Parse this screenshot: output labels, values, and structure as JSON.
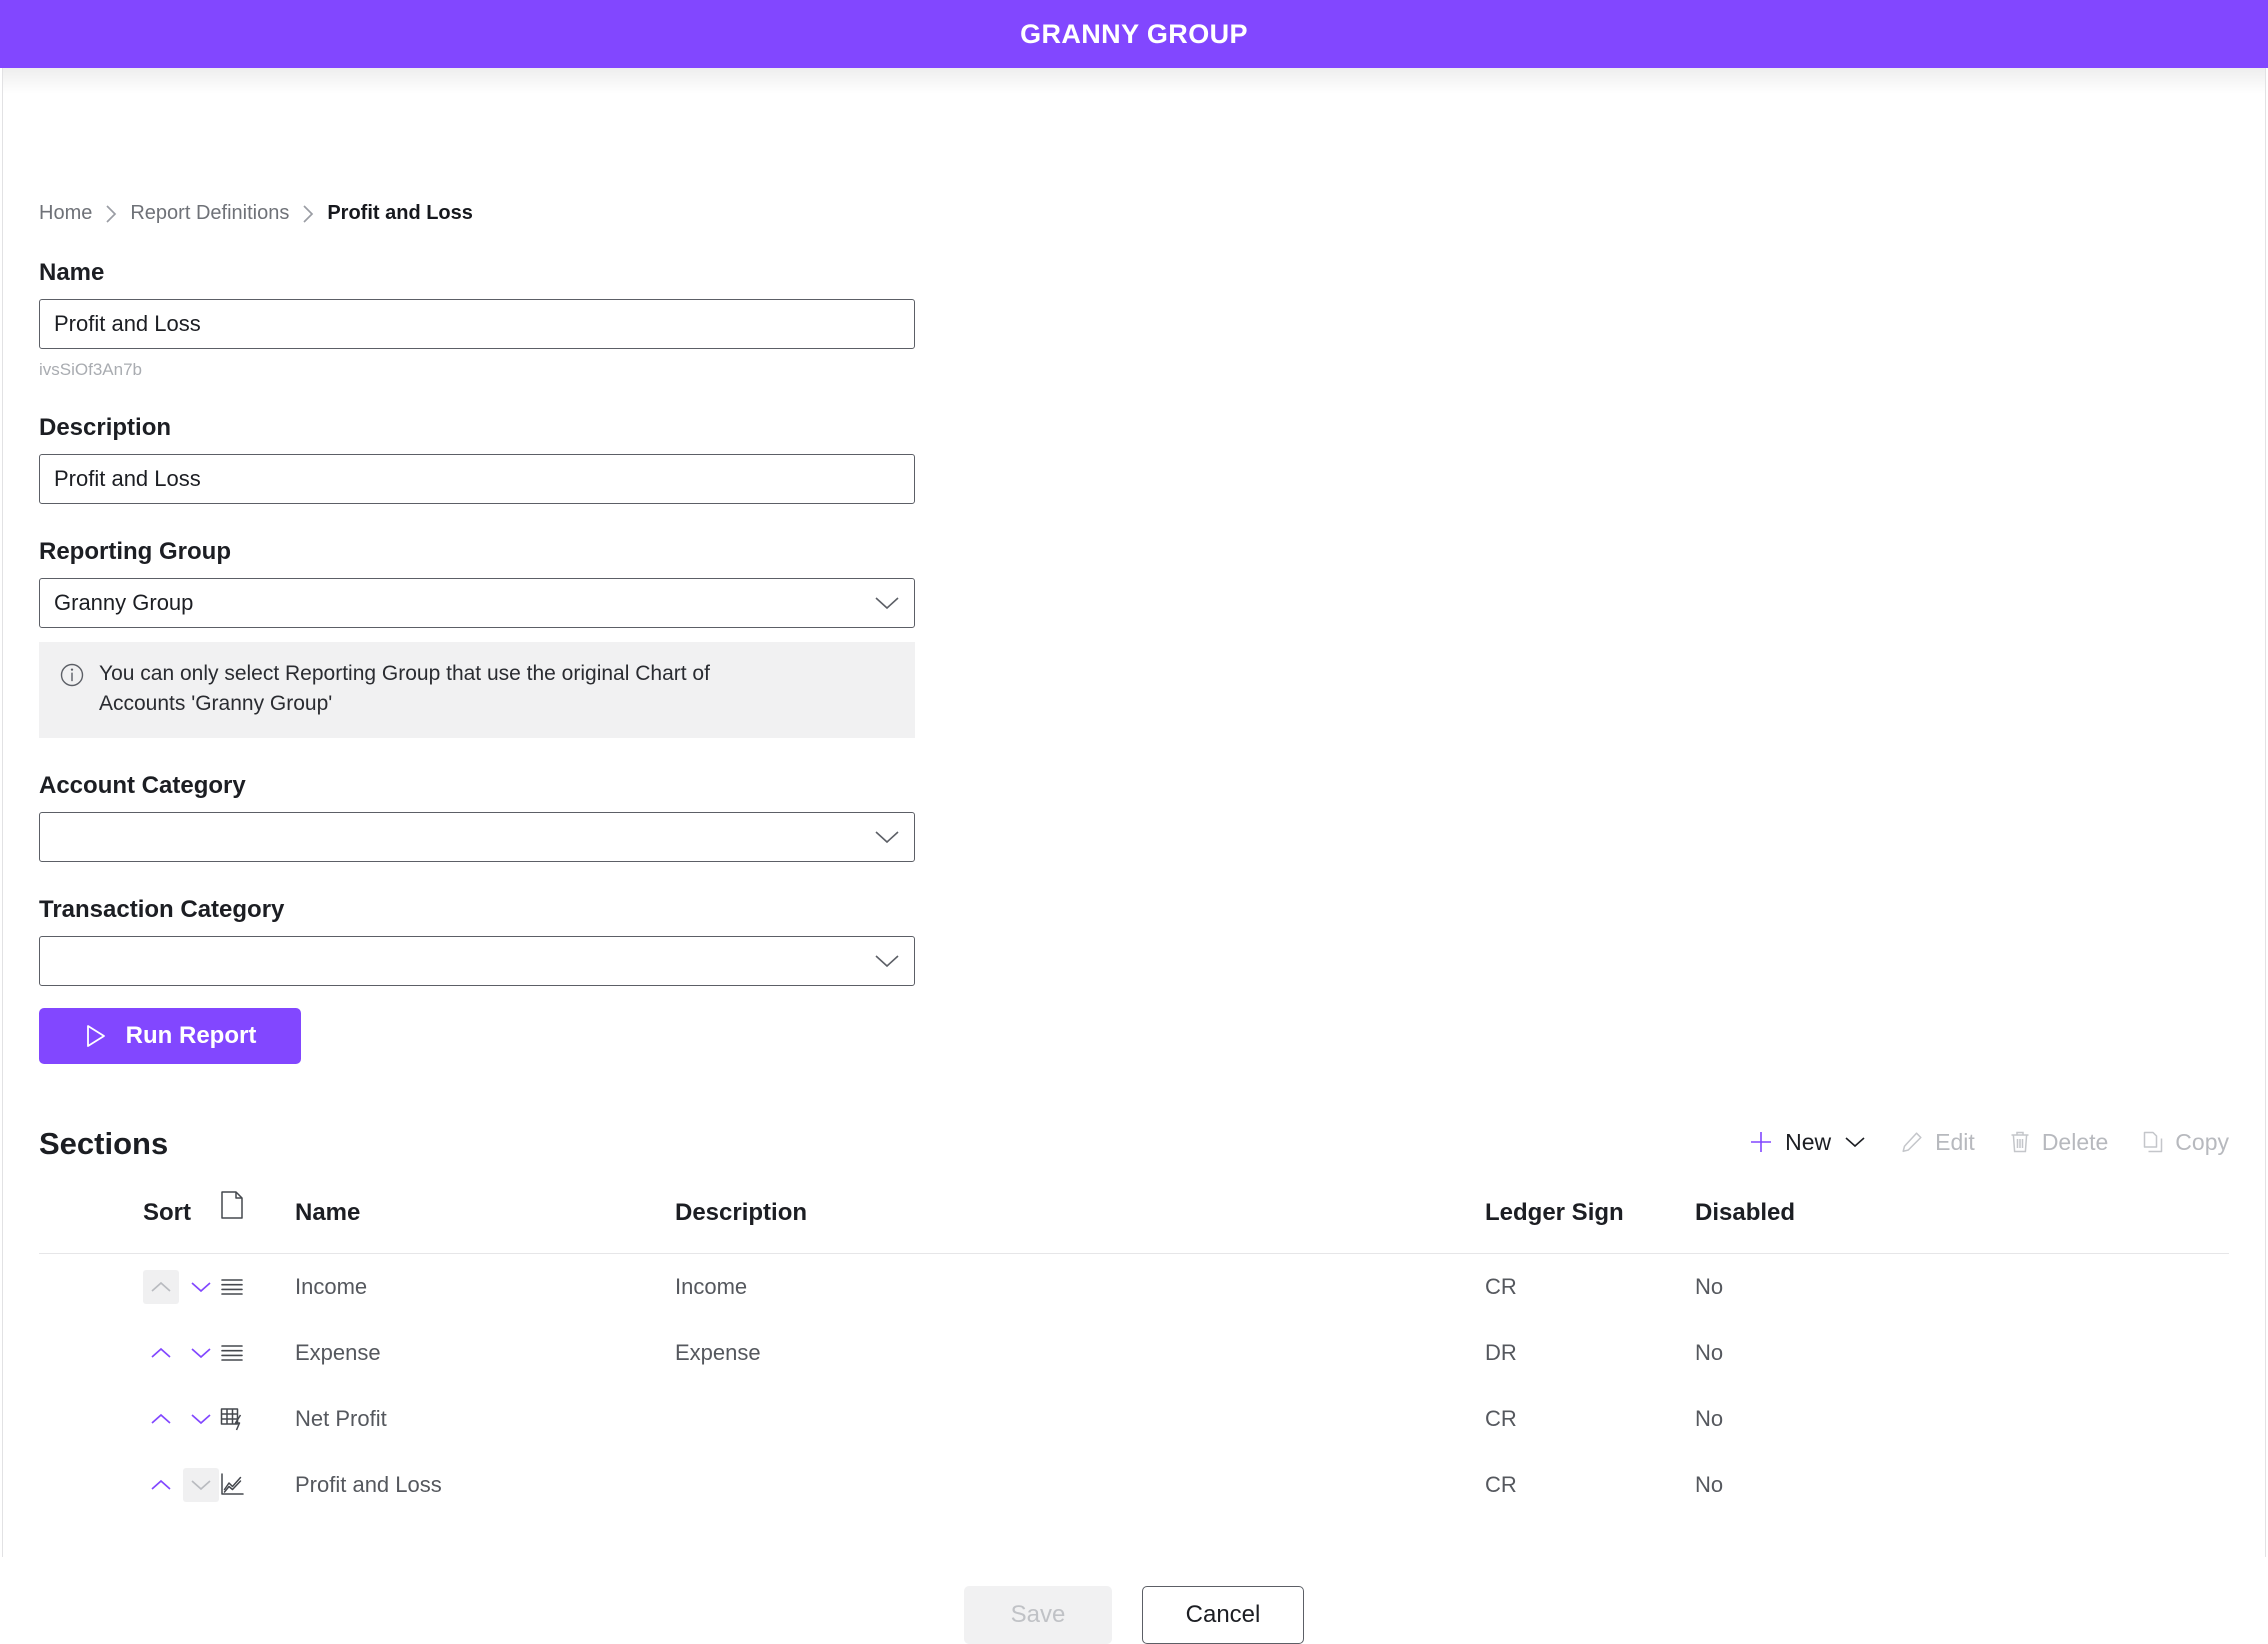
{
  "header": {
    "app_title": "GRANNY GROUP",
    "brand_color": "#8247FF"
  },
  "breadcrumb": {
    "items": [
      {
        "label": "Home"
      },
      {
        "label": "Report Definitions"
      },
      {
        "label": "Profit and Loss"
      }
    ]
  },
  "form": {
    "name": {
      "label": "Name",
      "value": "Profit and Loss",
      "placeholder": "",
      "id_hint": "ivsSiOf3An7b"
    },
    "description": {
      "label": "Description",
      "value": "Profit and Loss",
      "placeholder": ""
    },
    "reporting_group": {
      "label": "Reporting Group",
      "value": "Granny Group",
      "info": "You can only select Reporting Group that use the original Chart of Accounts 'Granny Group'"
    },
    "account_category": {
      "label": "Account Category",
      "value": ""
    },
    "transaction_category": {
      "label": "Transaction Category",
      "value": ""
    },
    "run_report_label": "Run Report"
  },
  "sections": {
    "title": "Sections",
    "toolbar": [
      {
        "label": "New",
        "icon": "plus-icon",
        "enabled": true,
        "has_chevron": true
      },
      {
        "label": "Edit",
        "icon": "pencil-icon",
        "enabled": false,
        "has_chevron": false
      },
      {
        "label": "Delete",
        "icon": "trash-icon",
        "enabled": false,
        "has_chevron": false
      },
      {
        "label": "Copy",
        "icon": "copy-icon",
        "enabled": false,
        "has_chevron": false
      }
    ],
    "columns": {
      "sort": "Sort",
      "type_icon": "document-icon",
      "name": "Name",
      "description": "Description",
      "ledger_sign": "Ledger Sign",
      "disabled": "Disabled"
    },
    "rows": [
      {
        "name": "Income",
        "description": "Income",
        "ledger_sign": "CR",
        "disabled": "No",
        "type_icon": "lines-list-icon",
        "sort_up_enabled": false,
        "sort_down_enabled": true
      },
      {
        "name": "Expense",
        "description": "Expense",
        "ledger_sign": "DR",
        "disabled": "No",
        "type_icon": "lines-list-icon",
        "sort_up_enabled": true,
        "sort_down_enabled": true
      },
      {
        "name": "Net Profit",
        "description": "",
        "ledger_sign": "CR",
        "disabled": "No",
        "type_icon": "table-lightning-icon",
        "sort_up_enabled": true,
        "sort_down_enabled": true
      },
      {
        "name": "Profit and Loss",
        "description": "",
        "ledger_sign": "CR",
        "disabled": "No",
        "type_icon": "line-chart-icon",
        "sort_up_enabled": true,
        "sort_down_enabled": false
      }
    ]
  },
  "footer": {
    "save_label": "Save",
    "save_enabled": false,
    "cancel_label": "Cancel"
  }
}
